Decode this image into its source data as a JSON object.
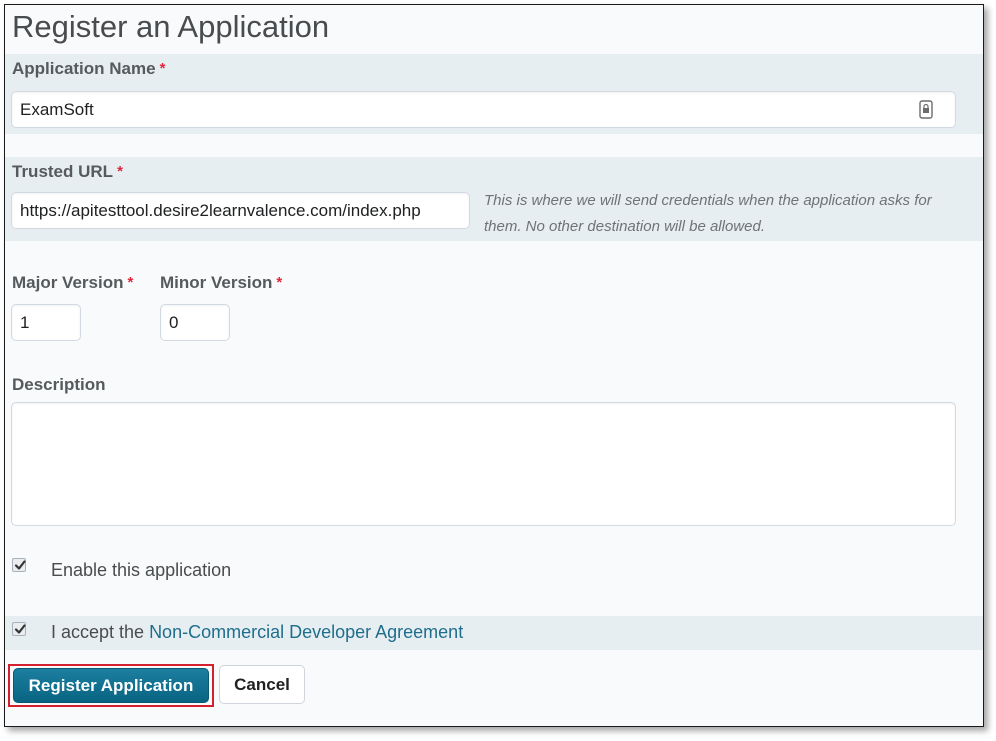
{
  "page": {
    "title": "Register an Application"
  },
  "form": {
    "app_name": {
      "label": "Application Name",
      "required_mark": "*",
      "value": "ExamSoft"
    },
    "trusted_url": {
      "label": "Trusted URL",
      "required_mark": "*",
      "value": "https://apitesttool.desire2learnvalence.com/index.php",
      "help_line1": "This is where we will send credentials when the application asks for",
      "help_line2": "them. No other destination will be allowed."
    },
    "major_version": {
      "label": "Major Version",
      "required_mark": "*",
      "value": "1"
    },
    "minor_version": {
      "label": "Minor Version",
      "required_mark": "*",
      "value": "0"
    },
    "description": {
      "label": "Description",
      "value": ""
    },
    "enable": {
      "label": "Enable this application",
      "checked": true
    },
    "agreement": {
      "prefix": "I accept the ",
      "link_text": "Non-Commercial Developer Agreement",
      "checked": true
    }
  },
  "actions": {
    "register_label": "Register Application",
    "cancel_label": "Cancel"
  },
  "icons": {
    "autofill": "password-manager-icon",
    "check": "checkmark-icon"
  },
  "colors": {
    "primary_button": "#096482",
    "required_asterisk": "#e2263a",
    "link": "#1e6e8c",
    "band": "#e7eef1",
    "highlight": "#d4202e"
  }
}
